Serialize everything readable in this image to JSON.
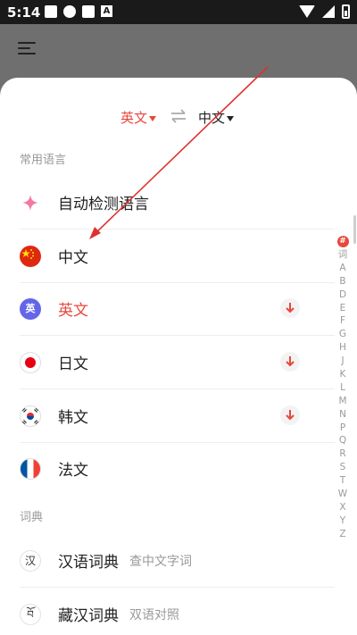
{
  "status_bar": {
    "time": "5:14",
    "a_badge": "A"
  },
  "header": {
    "menu_icon": "menu-icon"
  },
  "lang_switch": {
    "source": "英文",
    "target": "中文",
    "swap_icon": "swap-icon"
  },
  "sections": {
    "common": "常用语言",
    "dictionary": "词典"
  },
  "languages": [
    {
      "label": "自动检测语言",
      "icon": "sparkle-icon"
    },
    {
      "label": "中文",
      "icon": "china-flag-icon"
    },
    {
      "label": "英文",
      "icon": "english-badge-icon",
      "badge": "英",
      "active": true,
      "download": true
    },
    {
      "label": "日文",
      "icon": "japan-flag-icon",
      "download": true
    },
    {
      "label": "韩文",
      "icon": "korea-flag-icon",
      "download": true
    },
    {
      "label": "法文",
      "icon": "france-flag-icon"
    }
  ],
  "dictionaries": [
    {
      "label": "汉语词典",
      "sub": "查中文字词",
      "icon_char": "汉"
    },
    {
      "label": "藏汉词典",
      "sub": "双语对照",
      "icon_char": "བོ"
    }
  ],
  "index": {
    "hash": "#",
    "ci": "词",
    "letters": [
      "A",
      "B",
      "D",
      "E",
      "F",
      "G",
      "H",
      "J",
      "K",
      "L",
      "M",
      "N",
      "P",
      "Q",
      "R",
      "S",
      "T",
      "W",
      "X",
      "Y",
      "Z"
    ]
  },
  "colors": {
    "accent": "#e8473c",
    "annotation_arrow": "#e03030"
  }
}
